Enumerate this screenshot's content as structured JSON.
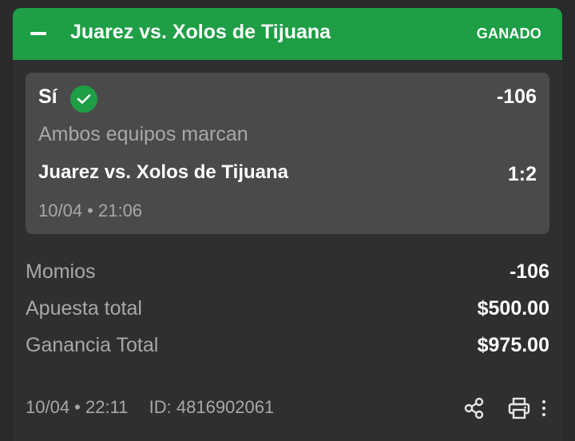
{
  "header": {
    "title": "Juarez vs. Xolos de Tijuana",
    "status": "GANADO",
    "accent_color": "#1e9e45",
    "collapse_icon": "minus-icon"
  },
  "selection": {
    "pick": "Sí",
    "pick_status_icon": "check-circle-icon",
    "odds": "-106",
    "market": "Ambos equipos marcan",
    "event": "Juarez vs. Xolos de Tijuana",
    "score": "1:2",
    "datetime": "10/04 • 21:06"
  },
  "summary": [
    {
      "label": "Momios",
      "value": "-106"
    },
    {
      "label": "Apuesta total",
      "value": "$500.00"
    },
    {
      "label": "Ganancia Total",
      "value": "$975.00"
    }
  ],
  "footer": {
    "datetime": "10/04 • 22:11",
    "id": "ID: 4816902061",
    "icons": [
      "share-icon",
      "print-icon",
      "more-vertical-icon"
    ]
  }
}
